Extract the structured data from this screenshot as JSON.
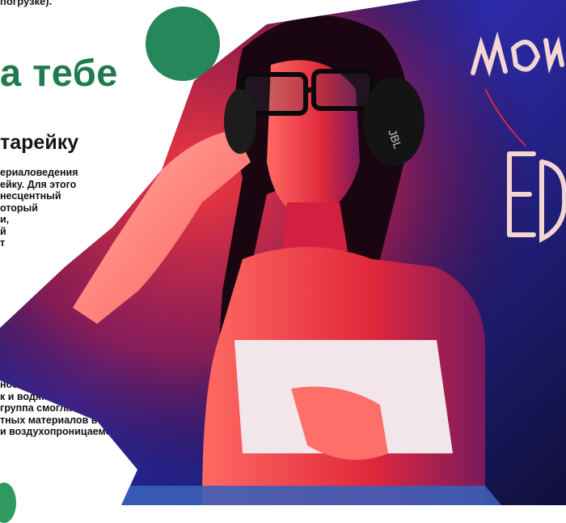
{
  "article": {
    "top_line": "погрузке).",
    "headline": "а тебе",
    "subheading": "тарейку",
    "para1": [
      "ериаловедения",
      "ейку. Для этого",
      "несцентный",
      "оторый",
      "и,",
      "й",
      "",
      "",
      "т"
    ],
    "para2": [
      "ности, так как не",
      "к и водяной пар.",
      "группа смогла",
      "тных материалов в",
      "и воздухопроницаемость."
    ]
  },
  "photo": {
    "neon_sign_top": "WOW",
    "neon_sign_bottom": "EDI",
    "headphones_brand": "JBL"
  },
  "colors": {
    "accent_green": "#26875a",
    "headline_green": "#1f7a4c",
    "neon_red": "#ff2a3a",
    "neon_blue": "#2a2fb8"
  }
}
